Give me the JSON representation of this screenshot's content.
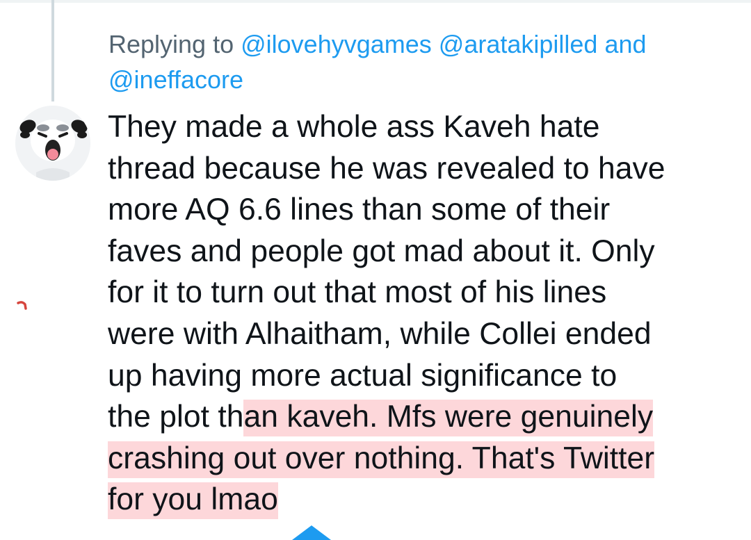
{
  "reply": {
    "prefix": "Replying to ",
    "mention_1": "@ilovehyvgames",
    "mention_2": "@aratakipilled",
    "conjunction": " and",
    "mention_3": "@ineffacore"
  },
  "tweet": {
    "lines": [
      "They made a whole ass Kaveh hate",
      "thread because he was revealed to have",
      "more AQ 6.6 lines than some of their",
      "faves and people got mad about it. Only",
      "for it to turn out that most of his lines",
      "were with Alhaitham, while Collei ended",
      "up having more actual significance to"
    ],
    "line8_plain": "the plot th",
    "line8_highlighted": "an kaveh. Mfs were genuinely",
    "line9_highlighted": "crashing out over nothing. That's Twitter",
    "line10_highlighted": "for you lmao"
  },
  "colors": {
    "mention": "#1d9bf0",
    "secondary_text": "#536471",
    "primary_text": "#0f1419",
    "highlight": "#fdd7da",
    "thread_line": "#cfd9de"
  },
  "icons": {
    "avatar": "screaming-cartoon-avatar",
    "red_mark": "red-ink-mark",
    "blue_shape": "blue-triangle-icon"
  }
}
